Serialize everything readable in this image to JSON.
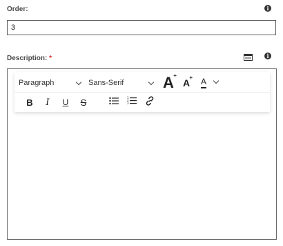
{
  "order": {
    "label": "Order:",
    "value": "3"
  },
  "description": {
    "label": "Description:",
    "required_mark": "*",
    "content": ""
  },
  "toolbar": {
    "block_format": "Paragraph",
    "font_family": "Sans-Serif",
    "font_grow_glyph": "A",
    "font_shrink_glyph": "A",
    "font_color_glyph": "A",
    "bold_glyph": "B",
    "italic_glyph": "I",
    "underline_glyph": "U",
    "strike_glyph": "S"
  },
  "icons": {
    "order_info": "info-icon",
    "description_info": "info-icon",
    "description_view": "editor-view-icon"
  },
  "colors": {
    "required": "#d0312d",
    "border": "#5a5a5a"
  }
}
